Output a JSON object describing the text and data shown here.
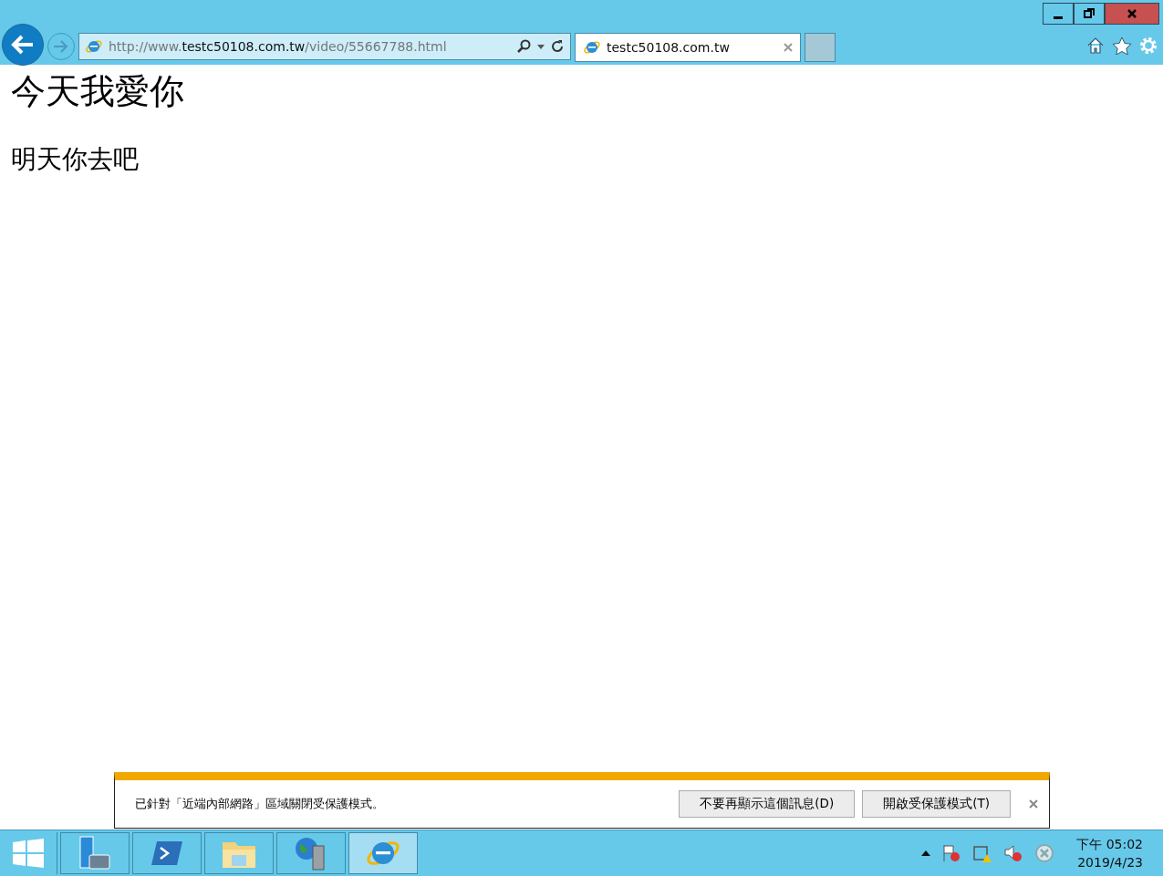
{
  "browser": {
    "address": "http://www.**testc50108.com.tw**/video/55667788.html",
    "tabs": [
      {
        "title": "testc50108.com.tw",
        "selected": true
      }
    ]
  },
  "page": {
    "heading": "今天我愛你",
    "paragraph": "明天你去吧"
  },
  "notification": {
    "message": "已針對「近端內部網路」區域關閉受保護模式。",
    "buttons": [
      "不要再顯示這個訊息(D)",
      "開啟受保護模式(T)"
    ]
  },
  "taskbar": {
    "items": [
      {
        "kind": "server",
        "selected": false
      },
      {
        "kind": "powershell",
        "selected": false
      },
      {
        "kind": "folder",
        "selected": false
      },
      {
        "kind": "network",
        "selected": false
      },
      {
        "kind": "ie",
        "selected": true
      }
    ],
    "time": "下午 05:02",
    "date": "2019/4/23"
  }
}
